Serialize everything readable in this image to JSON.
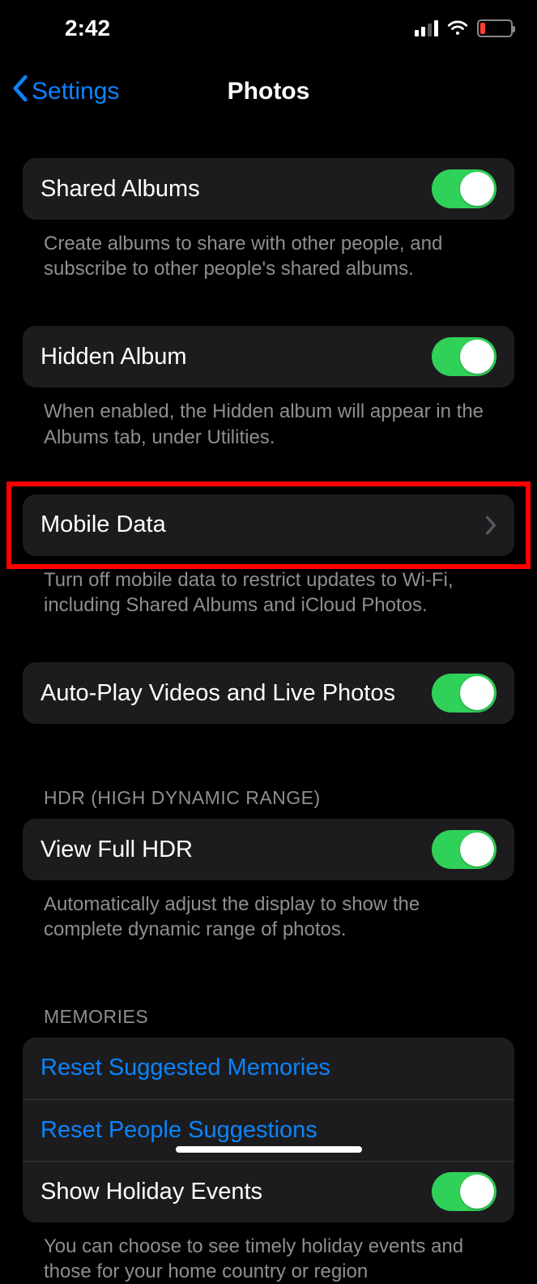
{
  "status": {
    "time": "2:42"
  },
  "nav": {
    "back_label": "Settings",
    "title": "Photos"
  },
  "shared_albums": {
    "title": "Shared Albums",
    "footer": "Create albums to share with other people, and subscribe to other people's shared albums."
  },
  "hidden_album": {
    "title": "Hidden Album",
    "footer": "When enabled, the Hidden album will appear in the Albums tab, under Utilities."
  },
  "mobile_data": {
    "title": "Mobile Data",
    "footer": "Turn off mobile data to restrict updates to Wi-Fi, including Shared Albums and iCloud Photos."
  },
  "autoplay": {
    "title": "Auto-Play Videos and Live Photos"
  },
  "hdr": {
    "header": "HDR (HIGH DYNAMIC RANGE)",
    "title": "View Full HDR",
    "footer": "Automatically adjust the display to show the complete dynamic range of photos."
  },
  "memories": {
    "header": "MEMORIES",
    "reset_suggested": "Reset Suggested Memories",
    "reset_people": "Reset People Suggestions",
    "show_holiday": "Show Holiday Events",
    "footer": "You can choose to see timely holiday events and those for your home country or region"
  }
}
